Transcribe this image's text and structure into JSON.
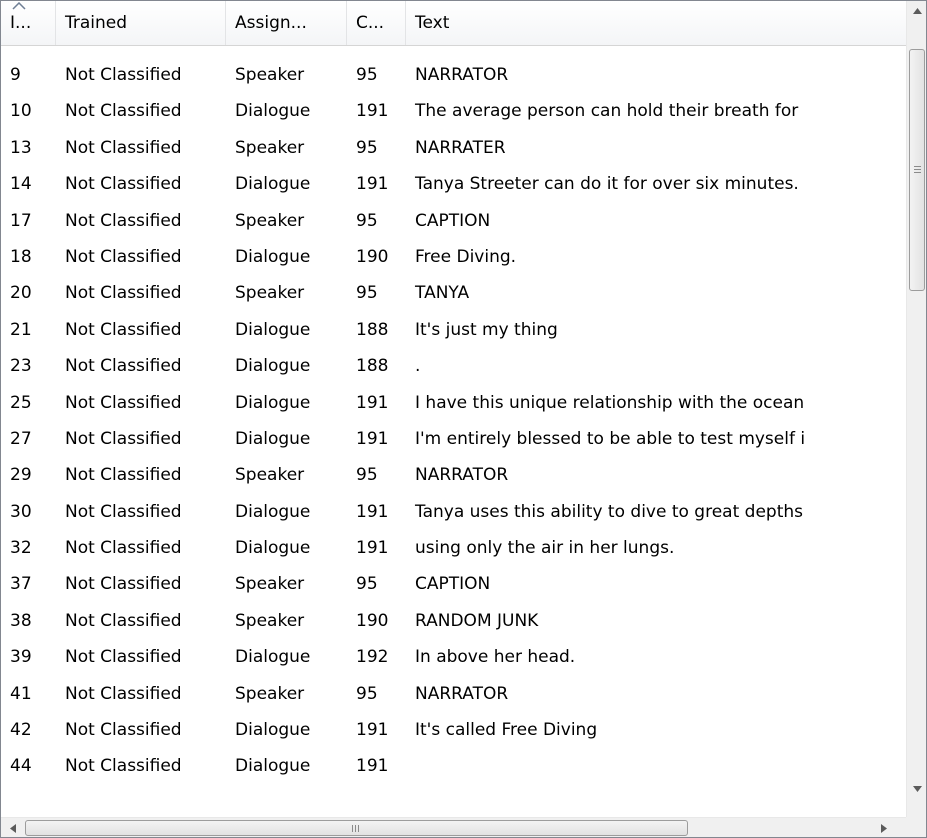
{
  "columns": [
    {
      "key": "id",
      "label": "I..."
    },
    {
      "key": "trained",
      "label": "Trained"
    },
    {
      "key": "assign",
      "label": "Assign..."
    },
    {
      "key": "c",
      "label": "C..."
    },
    {
      "key": "text",
      "label": "Text"
    }
  ],
  "rows": [
    {
      "id": "9",
      "trained": "Not Classified",
      "assign": "Speaker",
      "c": "95",
      "text": "NARRATOR"
    },
    {
      "id": "10",
      "trained": "Not Classified",
      "assign": "Dialogue",
      "c": "191",
      "text": "The average person can hold their breath for"
    },
    {
      "id": "13",
      "trained": "Not Classified",
      "assign": "Speaker",
      "c": "95",
      "text": "NARRATER"
    },
    {
      "id": "14",
      "trained": "Not Classified",
      "assign": "Dialogue",
      "c": "191",
      "text": "Tanya Streeter can do it for over six minutes."
    },
    {
      "id": "17",
      "trained": "Not Classified",
      "assign": "Speaker",
      "c": "95",
      "text": "CAPTION"
    },
    {
      "id": "18",
      "trained": "Not Classified",
      "assign": "Dialogue",
      "c": "190",
      "text": "Free Diving."
    },
    {
      "id": "20",
      "trained": "Not Classified",
      "assign": "Speaker",
      "c": "95",
      "text": "TANYA"
    },
    {
      "id": "21",
      "trained": "Not Classified",
      "assign": "Dialogue",
      "c": "188",
      "text": "It's just my thing"
    },
    {
      "id": "23",
      "trained": "Not Classified",
      "assign": "Dialogue",
      "c": "188",
      "text": "."
    },
    {
      "id": "25",
      "trained": "Not Classified",
      "assign": "Dialogue",
      "c": "191",
      "text": "I have this unique relationship with the ocean"
    },
    {
      "id": "27",
      "trained": "Not Classified",
      "assign": "Dialogue",
      "c": "191",
      "text": "I'm entirely blessed to be able to test myself i"
    },
    {
      "id": "29",
      "trained": "Not Classified",
      "assign": "Speaker",
      "c": "95",
      "text": "NARRATOR"
    },
    {
      "id": "30",
      "trained": "Not Classified",
      "assign": "Dialogue",
      "c": "191",
      "text": "Tanya uses this ability to dive to great depths"
    },
    {
      "id": "32",
      "trained": "Not Classified",
      "assign": "Dialogue",
      "c": "191",
      "text": "using only the air in her lungs."
    },
    {
      "id": "37",
      "trained": "Not Classified",
      "assign": "Speaker",
      "c": "95",
      "text": "CAPTION"
    },
    {
      "id": "38",
      "trained": "Not Classified",
      "assign": "Speaker",
      "c": "190",
      "text": "RANDOM JUNK"
    },
    {
      "id": "39",
      "trained": "Not Classified",
      "assign": "Dialogue",
      "c": "192",
      "text": "In above her head."
    },
    {
      "id": "41",
      "trained": "Not Classified",
      "assign": "Speaker",
      "c": "95",
      "text": "NARRATOR"
    },
    {
      "id": "42",
      "trained": "Not Classified",
      "assign": "Dialogue",
      "c": "191",
      "text": "It's called Free Diving"
    },
    {
      "id": "44",
      "trained": "Not Classified",
      "assign": "Dialogue",
      "c": "191",
      "text": ""
    }
  ],
  "icons": {
    "sort": "sort-ascending-icon",
    "scroll_up": "chevron-up-icon",
    "scroll_down": "chevron-down-icon",
    "scroll_left": "chevron-left-icon",
    "scroll_right": "chevron-right-icon"
  }
}
